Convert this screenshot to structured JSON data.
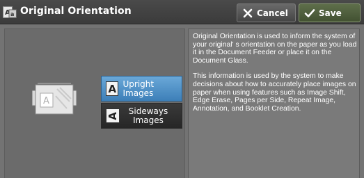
{
  "header": {
    "title": "Original Orientation",
    "cancel_label": "Cancel",
    "save_label": "Save"
  },
  "options": [
    {
      "letter": "A",
      "label": "Upright Images",
      "selected": true
    },
    {
      "letter": "A",
      "label": "Sideways Images",
      "selected": false
    }
  ],
  "preview": {
    "letter": "A"
  },
  "info": {
    "paragraph1": "Original Orientation is used to inform the system of your original' s orientation on the paper as you load it in the Document Feeder or place it on the Document Glass.",
    "paragraph2": "This information is used by the system to make decisions about how to accurately place images on paper when using features such as Image Shift, Edge Erase, Pages per Side, Repeat Image, Annotation, and Booklet Creation."
  },
  "colors": {
    "selected_option": "#4a8cc4",
    "title_bar": "#3f3f3f",
    "save_accent": "#4d5c3c"
  }
}
